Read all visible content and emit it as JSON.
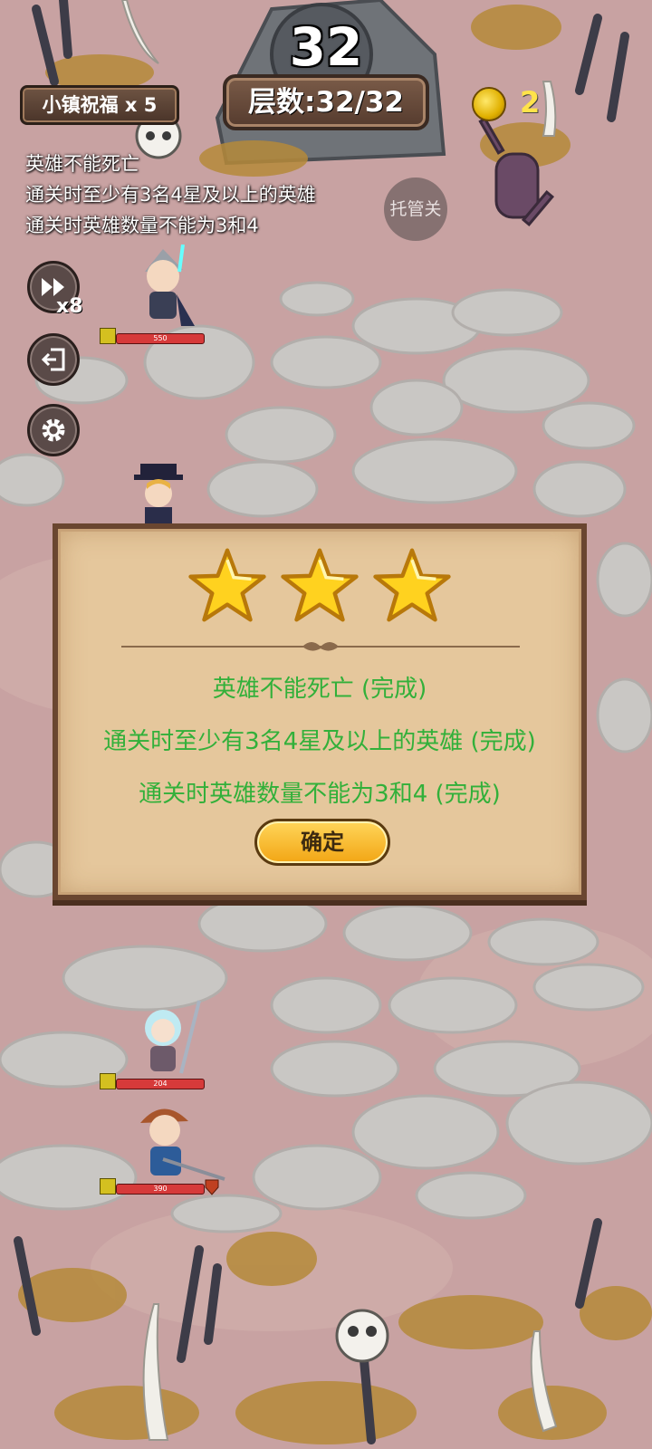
{
  "hud": {
    "timer": "32",
    "floor": "层数:32/32",
    "blessing": "小镇祝福 x 5",
    "coins": "2",
    "auto_label": "托管关",
    "speed_label": "x8",
    "icons": [
      "fast-forward-icon",
      "exit-icon",
      "gear-icon",
      "coin-icon"
    ]
  },
  "objectives": [
    "英雄不能死亡",
    "通关时至少有3名4星及以上的英雄",
    "通关时英雄数量不能为3和4"
  ],
  "heroes": [
    {
      "hp": "550"
    },
    {
      "hp": "204"
    },
    {
      "hp": "390"
    }
  ],
  "dialog": {
    "stars": 3,
    "results": [
      "英雄不能死亡 (完成)",
      "通关时至少有3名4星及以上的英雄 (完成)",
      "通关时英雄数量不能为3和4 (完成)"
    ],
    "confirm_label": "确定"
  },
  "colors": {
    "complete_text": "#32b03a",
    "coin": "#ffe34a",
    "hp_bar": "#d63a3a",
    "panel": "#e5c79c"
  }
}
